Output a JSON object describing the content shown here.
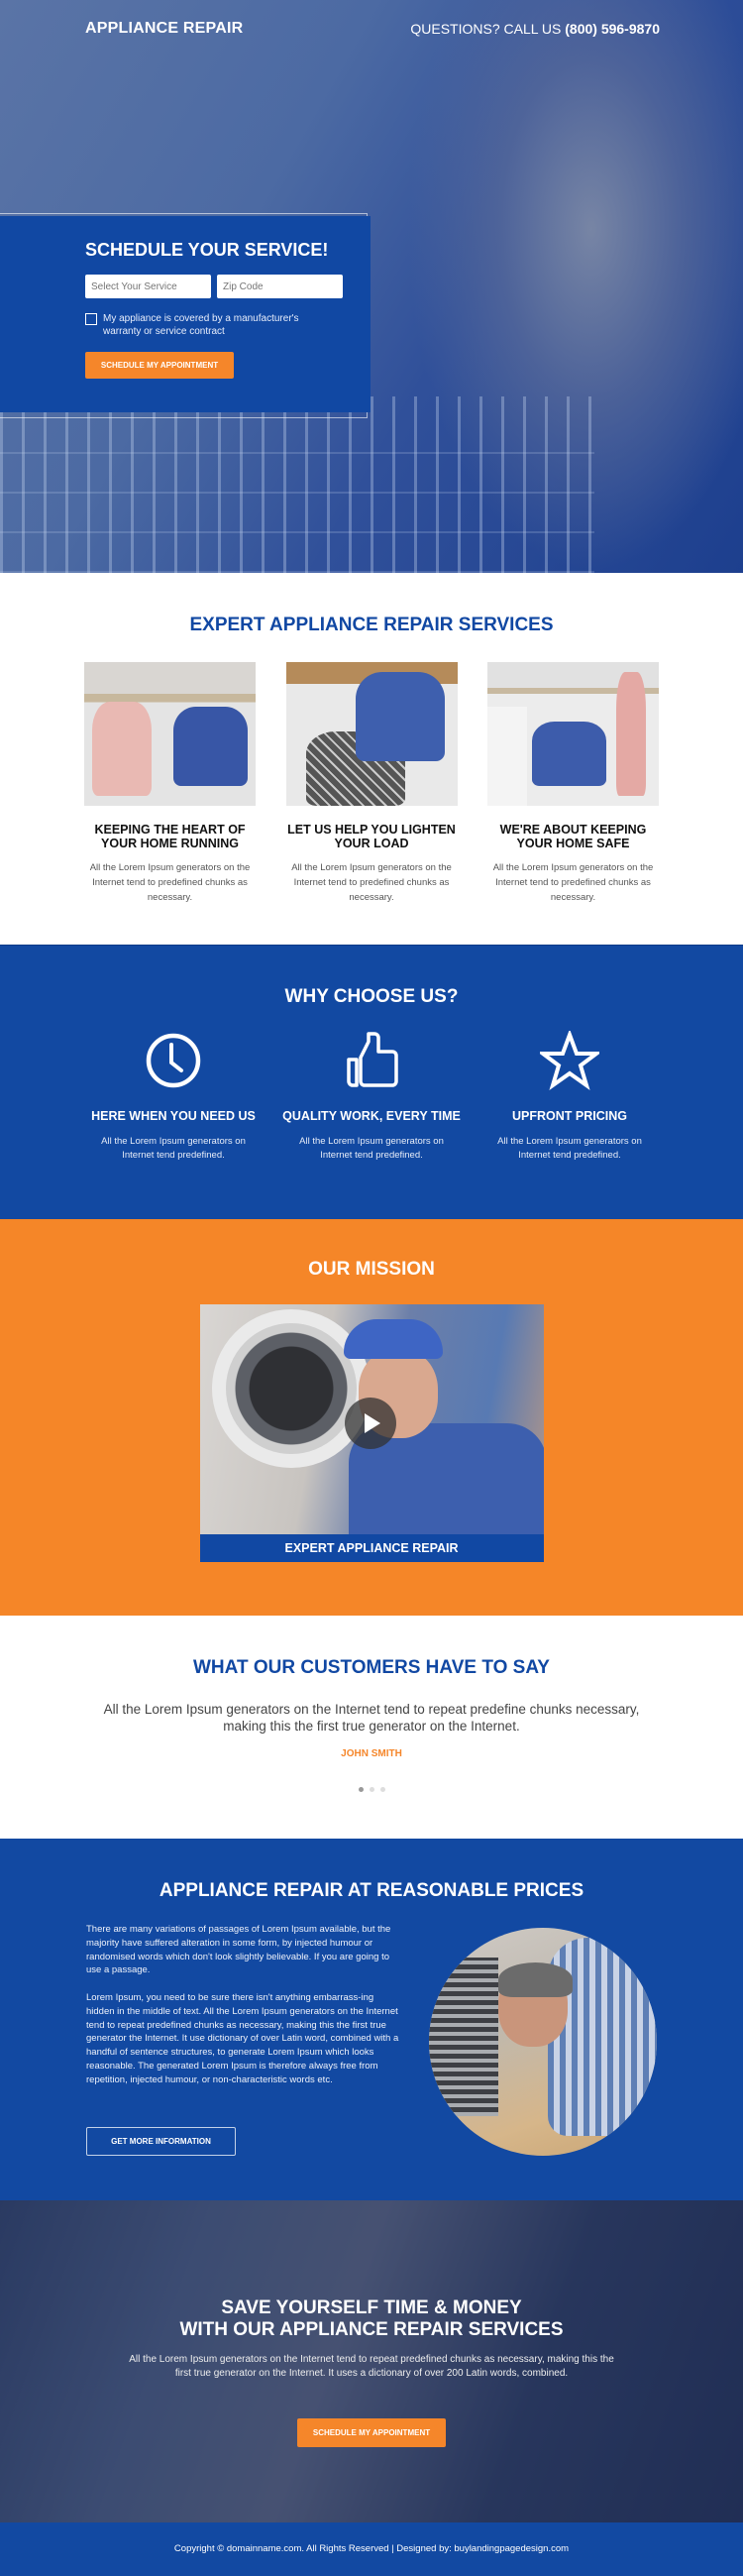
{
  "header": {
    "logo": "APPLIANCE REPAIR",
    "phone_prefix": "QUESTIONS? CALL US",
    "phone_number": "(800) 596-9870"
  },
  "hero_form": {
    "title": "SCHEDULE YOUR SERVICE!",
    "service_placeholder": "Select Your Service",
    "zip_placeholder": "Zip Code",
    "checkbox_label": "My appliance is covered by a manufacturer's warranty or service contract",
    "checkbox_checked": false,
    "submit_label": "SCHEDULE MY APPOINTMENT"
  },
  "services": {
    "title": "EXPERT APPLIANCE REPAIR SERVICES",
    "items": [
      {
        "title": "KEEPING THE HEART OF YOUR HOME RUNNING",
        "text": "All the Lorem Ipsum generators on the Internet tend to predefined chunks as necessary."
      },
      {
        "title": "LET US HELP YOU LIGHTEN YOUR LOAD",
        "text": "All the Lorem Ipsum generators on the Internet tend to predefined chunks as necessary."
      },
      {
        "title": "WE'RE ABOUT KEEPING YOUR HOME SAFE",
        "text": "All the Lorem Ipsum generators on the Internet tend to predefined chunks as necessary."
      }
    ]
  },
  "why": {
    "title": "WHY CHOOSE US?",
    "items": [
      {
        "icon": "clock-icon",
        "title": "HERE WHEN YOU NEED US",
        "text": "All the Lorem Ipsum generators on Internet tend  predefined."
      },
      {
        "icon": "thumbs-up-icon",
        "title": "QUALITY WORK, EVERY TIME",
        "text": "All the Lorem Ipsum generators on Internet tend  predefined."
      },
      {
        "icon": "star-icon",
        "title": "UPFRONT PRICING",
        "text": "All the Lorem Ipsum generators on Internet tend  predefined."
      }
    ]
  },
  "mission": {
    "title": "OUR MISSION",
    "video_caption": "EXPERT APPLIANCE REPAIR"
  },
  "testimonials": {
    "title": "WHAT OUR CUSTOMERS HAVE TO SAY",
    "quote": "All the Lorem Ipsum generators on the Internet tend to repeat predefine chunks necessary, making this the first true generator on the Internet.",
    "author": "JOHN SMITH",
    "slide_count": 3,
    "active_slide": 1
  },
  "pricing": {
    "title": "APPLIANCE REPAIR AT REASONABLE PRICES",
    "paragraph1": "There are many variations of passages of Lorem Ipsum available, but the majority have suffered alteration in some form, by injected humour or randomised words which don't look slightly believable. If you are going to use a passage.",
    "paragraph2": "Lorem Ipsum, you need to be sure there isn't anything embarrass-ing hidden in the middle of text. All the Lorem Ipsum generators on the Internet tend to repeat predefined chunks as necessary, making this the first true generator the Internet. It use dictionary of over Latin word, combined with a handful of sentence structures, to generate Lorem Ipsum which looks reasonable. The generated Lorem Ipsum is therefore always free from repetition, injected humour, or non-characteristic words etc.",
    "button_label": "GET MORE INFORMATION"
  },
  "cta": {
    "title_line1": "SAVE YOURSELF TIME & MONEY",
    "title_line2": "WITH OUR APPLIANCE REPAIR SERVICES",
    "text": "All the Lorem Ipsum generators on the Internet tend to repeat predefined chunks as necessary, making this the first true generator on the Internet. It uses a dictionary of over 200 Latin words, combined.",
    "button_label": "SCHEDULE MY APPOINTMENT"
  },
  "footer": {
    "text": "Copyright © domainname.com. All Rights Reserved | Designed by: buylandingpagedesign.com"
  },
  "colors": {
    "primary_blue": "#1249a2",
    "accent_orange": "#f5862a",
    "text_dark": "#111111"
  }
}
